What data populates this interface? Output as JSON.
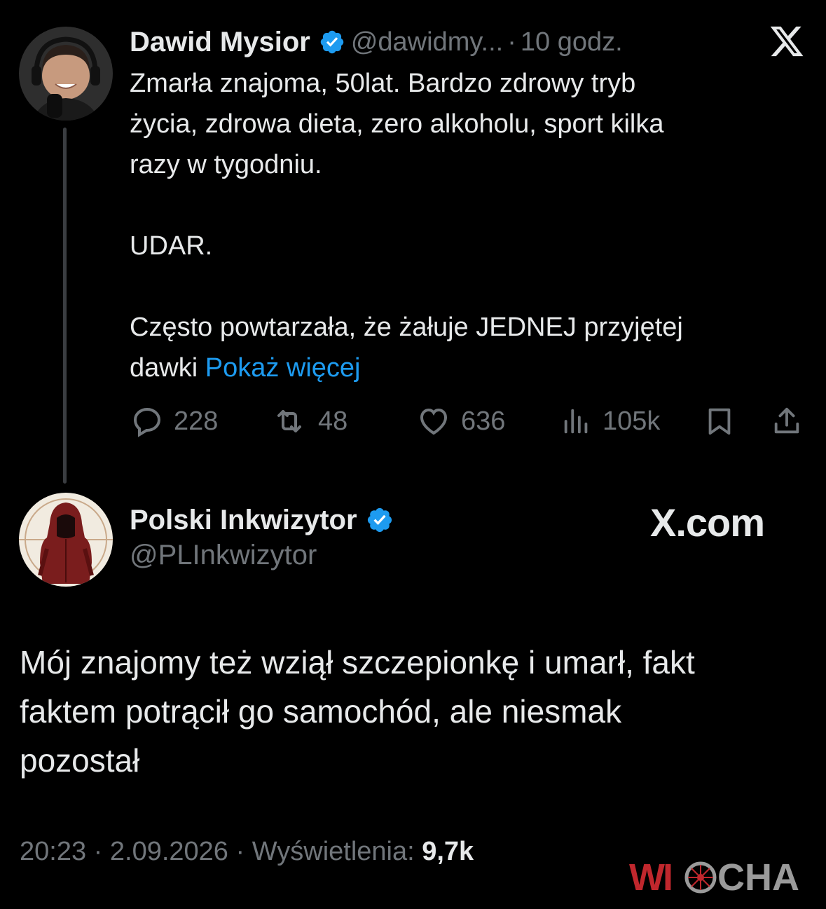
{
  "tweet": {
    "author_name": "Dawid Mysior",
    "author_handle": "@dawidmy...",
    "separator": "·",
    "time": "10 godz.",
    "lines": [
      "Zmarła znajoma, 50lat. Bardzo zdrowy tryb",
      "życia,  zdrowa dieta, zero alkoholu, sport kilka",
      "razy w tygodniu.",
      "UDAR.",
      "Często powtarzała, że żałuje JEDNEJ przyjętej",
      "dawki"
    ],
    "show_more": "Pokaż więcej",
    "stats": {
      "replies": "228",
      "retweets": "48",
      "likes": "636",
      "views": "105k"
    }
  },
  "reply": {
    "author_name": "Polski Inkwizytor",
    "author_handle": "@PLInkwizytor",
    "brand": "X.com",
    "lines": [
      "Mój znajomy też wziął szczepionkę i umarł, fakt",
      "faktem potrącił go samochód, ale niesmak",
      "pozostał"
    ],
    "time": "20:23",
    "date": "2.09.2026",
    "views_label": "Wyświetlenia:",
    "views_count": "9,7k",
    "separator": "·"
  },
  "watermark": {
    "text": "WIOCHA"
  },
  "colors": {
    "background": "#000000",
    "text": "#e7e9ea",
    "secondary": "#71767b",
    "link": "#1d9bf0",
    "verified": "#1d9bf0",
    "watermark_red": "#c0272d",
    "watermark_gray": "#9a9a9a"
  },
  "icons": {
    "verified": "verified-badge-icon",
    "x_logo": "x-logo-icon",
    "reply": "reply-icon",
    "retweet": "retweet-icon",
    "like": "heart-icon",
    "views": "views-bars-icon",
    "bookmark": "bookmark-icon",
    "share": "share-icon"
  }
}
